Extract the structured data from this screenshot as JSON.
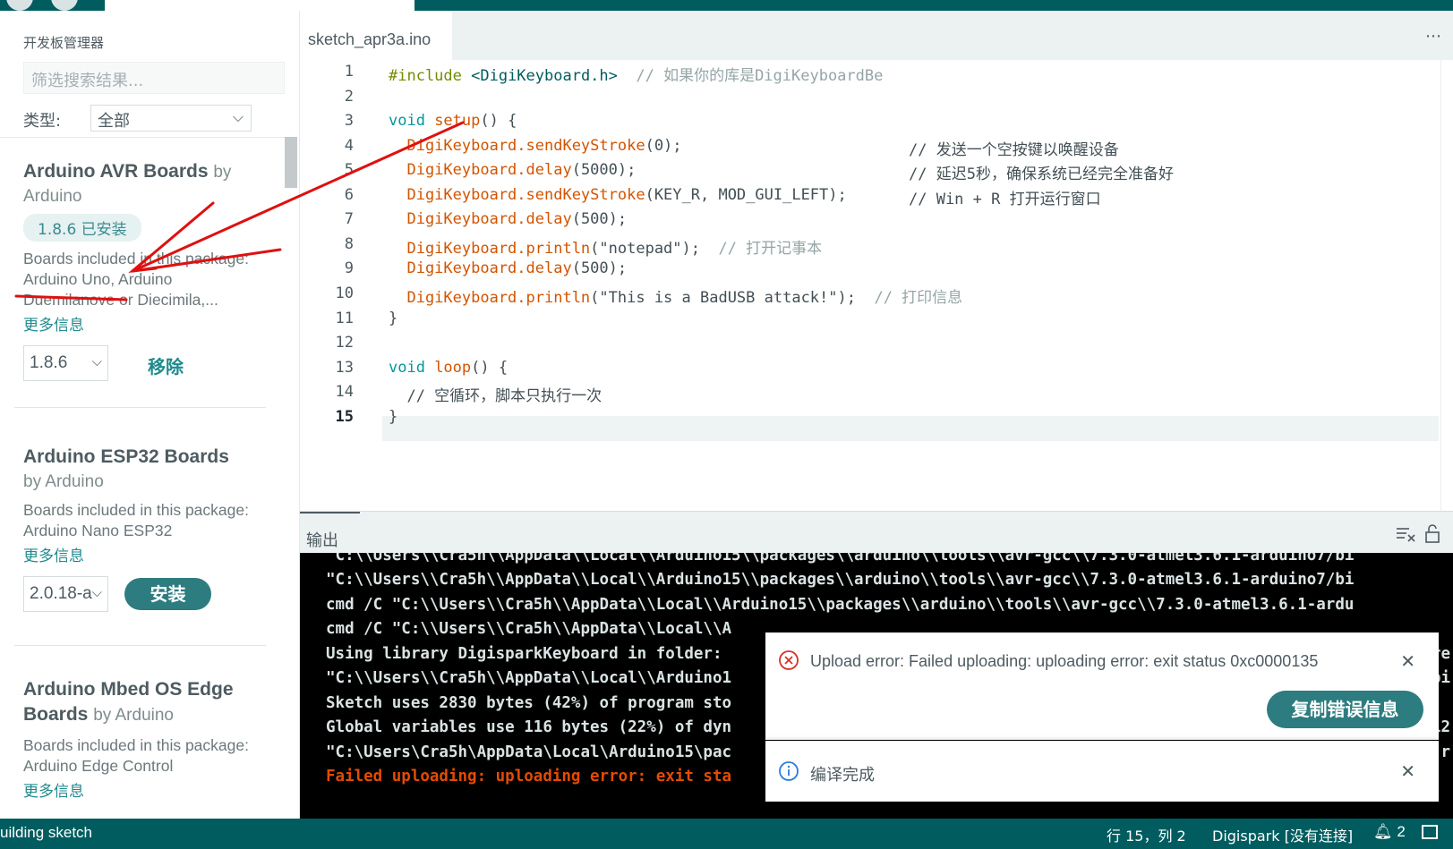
{
  "colors": {
    "teal": "#005c5f",
    "accent": "#2d7c80",
    "link": "#1f8a8e",
    "error_text": "#e34c00",
    "annotation": "#e01010"
  },
  "sidebar": {
    "title": "开发板管理器",
    "filter_placeholder": "筛选搜索结果...",
    "type_label": "类型:",
    "type_value": "全部",
    "boards": [
      {
        "name": "Arduino AVR Boards",
        "by": "by",
        "author": "Arduino",
        "installed_badge": "1.8.6 已安装",
        "desc_line1": "Boards included in this package:",
        "desc_line2": "Arduino Uno, Arduino",
        "desc_line3": "Duemilanove or Diecimila,...",
        "more": "更多信息",
        "version": "1.8.6",
        "action": "移除"
      },
      {
        "name": "Arduino ESP32 Boards",
        "author_line": "by Arduino",
        "desc_line1": "Boards included in this package:",
        "desc_line2": "Arduino Nano ESP32",
        "more": "更多信息",
        "version": "2.0.18-a",
        "action": "安装"
      },
      {
        "name_line1": "Arduino Mbed OS Edge",
        "name_line2": "Boards",
        "by_author": "by Arduino",
        "desc_line1": "Boards included in this package:",
        "desc_line2": "Arduino Edge Control",
        "more": "更多信息"
      }
    ]
  },
  "editor": {
    "tab": "sketch_apr3a.ino",
    "more_icon": "ellipsis-icon",
    "line_numbers": [
      "1",
      "2",
      "3",
      "4",
      "5",
      "6",
      "7",
      "8",
      "9",
      "10",
      "11",
      "12",
      "13",
      "14",
      "15"
    ],
    "active_line": "15",
    "code": {
      "l1_pp": "#include",
      "l1_inc": " <DigiKeyboard.h>",
      "l1_cmt": "  // 如果你的库是DigiKeyboardBe",
      "l3_kw": "void",
      "l3_fn": " setup",
      "l3_rest": "() {",
      "l4_obj": "  DigiKeyboard.sendKeyStroke",
      "l4_args": "(0);",
      "l4_cmt": "// 发送一个空按键以唤醒设备",
      "l5_obj": "  DigiKeyboard.delay",
      "l5_args": "(5000);",
      "l5_cmt": "// 延迟5秒，确保系统已经完全准备好",
      "l6_obj": "  DigiKeyboard.sendKeyStroke",
      "l6_args": "(KEY_R, MOD_GUI_LEFT);",
      "l6_cmt": "// Win + R 打开运行窗口",
      "l7_obj": "  DigiKeyboard.delay",
      "l7_args": "(500);",
      "l8_obj": "  DigiKeyboard.println",
      "l8_args": "(\"notepad\");",
      "l8_cmt": "  // 打开记事本",
      "l9_obj": "  DigiKeyboard.delay",
      "l9_args": "(500);",
      "l10_obj": "  DigiKeyboard.println",
      "l10_args": "(\"This is a BadUSB attack!\");",
      "l10_cmt": "  // 打印信息",
      "l11": "}",
      "l13_kw": "void",
      "l13_fn": " loop",
      "l13_rest": "() {",
      "l14_cmt": "  // 空循环，脚本只执行一次",
      "l15": "}"
    }
  },
  "output": {
    "title": "输出",
    "lines": [
      "\"C:\\\\Users\\\\Cra5h\\\\AppData\\\\Local\\\\Arduino15\\\\packages\\\\arduino\\\\tools\\\\avr-gcc\\\\7.3.0-atmel3.6.1-arduino7/bi",
      "\"C:\\\\Users\\\\Cra5h\\\\AppData\\\\Local\\\\Arduino15\\\\packages\\\\arduino\\\\tools\\\\avr-gcc\\\\7.3.0-atmel3.6.1-arduino7/bi",
      "cmd /C \"C:\\\\Users\\\\Cra5h\\\\AppData\\\\Local\\\\Arduino15\\\\packages\\\\arduino\\\\tools\\\\avr-gcc\\\\7.3.0-atmel3.6.1-ardu",
      "cmd /C \"C:\\\\Users\\\\Cra5h\\\\AppData\\\\Local\\\\A",
      "Using library DigisparkKeyboard in folder:",
      "\"C:\\\\Users\\\\Cra5h\\\\AppData\\\\Local\\\\Arduino1",
      "Sketch uses 2830 bytes (42%) of program sto",
      "Global variables use 116 bytes (22%) of dyn",
      "\"C:\\Users\\Cra5h\\AppData\\Local\\Arduino15\\pac",
      "Failed uploading: uploading error: exit sta"
    ],
    "right_fragments": [
      "re",
      "bi",
      "12",
      "-r"
    ]
  },
  "notifications": {
    "error_message": "Upload error: Failed uploading: uploading error: exit status 0xc0000135",
    "copy_button": "复制错误信息",
    "info_message": "编译完成"
  },
  "status": {
    "left": "uilding sketch",
    "position": "行 15，列 2",
    "board": "Digispark [没有连接]",
    "notifications_count": "2"
  }
}
